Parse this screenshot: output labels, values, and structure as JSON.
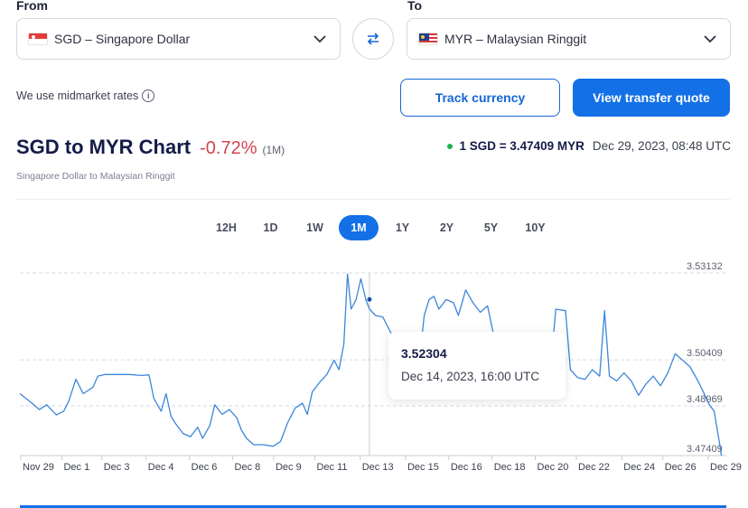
{
  "converter": {
    "from_label": "From",
    "to_label": "To",
    "from_value": "SGD – Singapore Dollar",
    "to_value": "MYR – Malaysian Ringgit",
    "midmarket_text": "We use midmarket rates",
    "track_button": "Track currency",
    "quote_button": "View transfer quote"
  },
  "header": {
    "title": "SGD to MYR Chart",
    "change": "-0.72%",
    "change_period": "(1M)",
    "subtitle": "Singapore Dollar to Malaysian Ringgit",
    "rate": "1 SGD = 3.47409 MYR",
    "timestamp": "Dec 29, 2023, 08:48 UTC"
  },
  "periods": [
    "12H",
    "1D",
    "1W",
    "1M",
    "1Y",
    "2Y",
    "5Y",
    "10Y"
  ],
  "active_period": "1M",
  "tooltip": {
    "value": "3.52304",
    "date": "Dec 14, 2023, 16:00 UTC"
  },
  "colors": {
    "accent": "#1370e6",
    "line": "#3c86da",
    "negative": "#d0454c",
    "live_dot": "#1fb24c"
  },
  "chart_data": {
    "type": "line",
    "series": [
      {
        "values": [
          [
            0,
            3.4935
          ],
          [
            0.5,
            3.4905
          ],
          [
            0.8,
            3.4885
          ],
          [
            1.1,
            3.49
          ],
          [
            1.5,
            3.4868
          ],
          [
            1.8,
            3.488
          ],
          [
            2.0,
            3.491
          ],
          [
            2.3,
            3.498
          ],
          [
            2.6,
            3.4935
          ],
          [
            3.0,
            3.4955
          ],
          [
            3.2,
            3.499
          ],
          [
            3.5,
            3.4995
          ],
          [
            4.0,
            3.4995
          ],
          [
            4.5,
            3.4995
          ],
          [
            5.0,
            3.4992
          ],
          [
            5.3,
            3.4994
          ],
          [
            5.5,
            3.492
          ],
          [
            5.8,
            3.488
          ],
          [
            6.0,
            3.4935
          ],
          [
            6.2,
            3.4865
          ],
          [
            6.4,
            3.484
          ],
          [
            6.7,
            3.481
          ],
          [
            7.0,
            3.48
          ],
          [
            7.3,
            3.483
          ],
          [
            7.5,
            3.4795
          ],
          [
            7.8,
            3.4835
          ],
          [
            8.0,
            3.49
          ],
          [
            8.3,
            3.487
          ],
          [
            8.6,
            3.4885
          ],
          [
            8.9,
            3.486
          ],
          [
            9.1,
            3.482
          ],
          [
            9.3,
            3.4795
          ],
          [
            9.6,
            3.4775
          ],
          [
            10.0,
            3.4775
          ],
          [
            10.4,
            3.477
          ],
          [
            10.7,
            3.4785
          ],
          [
            11.0,
            3.4845
          ],
          [
            11.3,
            3.489
          ],
          [
            11.6,
            3.4905
          ],
          [
            11.8,
            3.487
          ],
          [
            12.0,
            3.494
          ],
          [
            12.3,
            3.497
          ],
          [
            12.6,
            3.4995
          ],
          [
            12.9,
            3.504
          ],
          [
            13.1,
            3.501
          ],
          [
            13.3,
            3.509
          ],
          [
            13.45,
            3.531
          ],
          [
            13.6,
            3.52
          ],
          [
            13.8,
            3.523
          ],
          [
            14.0,
            3.5295
          ],
          [
            14.2,
            3.523
          ],
          [
            14.35,
            3.52
          ],
          [
            14.6,
            3.518
          ],
          [
            14.9,
            3.5175
          ],
          [
            15.2,
            3.513
          ],
          [
            15.5,
            3.509
          ],
          [
            15.8,
            3.506
          ],
          [
            16.0,
            3.508
          ],
          [
            16.2,
            3.506
          ],
          [
            16.4,
            3.504
          ],
          [
            16.6,
            3.518
          ],
          [
            16.8,
            3.523
          ],
          [
            17.0,
            3.524
          ],
          [
            17.2,
            3.52
          ],
          [
            17.5,
            3.523
          ],
          [
            17.8,
            3.522
          ],
          [
            18.0,
            3.518
          ],
          [
            18.3,
            3.526
          ],
          [
            18.6,
            3.522
          ],
          [
            18.9,
            3.519
          ],
          [
            19.2,
            3.521
          ],
          [
            19.5,
            3.51
          ],
          [
            19.8,
            3.503
          ],
          [
            20.1,
            3.501
          ],
          [
            20.4,
            3.499
          ],
          [
            20.7,
            3.4975
          ],
          [
            21.0,
            3.502
          ],
          [
            21.4,
            3.499
          ],
          [
            21.8,
            3.502
          ],
          [
            22.0,
            3.52
          ],
          [
            22.4,
            3.5195
          ],
          [
            22.6,
            3.501
          ],
          [
            22.9,
            3.4985
          ],
          [
            23.2,
            3.498
          ],
          [
            23.5,
            3.501
          ],
          [
            23.8,
            3.499
          ],
          [
            24.0,
            3.5195
          ],
          [
            24.2,
            3.499
          ],
          [
            24.5,
            3.4975
          ],
          [
            24.8,
            3.5
          ],
          [
            25.1,
            3.4975
          ],
          [
            25.4,
            3.493
          ],
          [
            25.7,
            3.4965
          ],
          [
            26.0,
            3.499
          ],
          [
            26.3,
            3.496
          ],
          [
            26.6,
            3.5
          ],
          [
            26.9,
            3.506
          ],
          [
            27.2,
            3.504
          ],
          [
            27.5,
            3.502
          ],
          [
            27.8,
            3.498
          ],
          [
            28.0,
            3.495
          ],
          [
            28.3,
            3.49
          ],
          [
            28.5,
            3.488
          ],
          [
            28.7,
            3.479
          ],
          [
            28.8,
            3.47409
          ]
        ]
      }
    ],
    "x_ticks": [
      "Nov 29",
      "Dec 1",
      "Dec 3",
      "Dec 4",
      "Dec 6",
      "Dec 8",
      "Dec 9",
      "Dec 11",
      "Dec 13",
      "Dec 15",
      "Dec 16",
      "Dec 18",
      "Dec 20",
      "Dec 22",
      "Dec 24",
      "Dec 26",
      "Dec 29"
    ],
    "x_tick_values": [
      0,
      1.9,
      3.75,
      5.8,
      7.8,
      9.8,
      11.7,
      13.6,
      15.7,
      17.8,
      19.8,
      21.8,
      23.8,
      25.7,
      27.8,
      29.7,
      31.8
    ],
    "y_ticks": [
      "3.53132",
      "3.50409",
      "3.48969",
      "3.47409"
    ],
    "y_tick_values": [
      3.53132,
      3.50409,
      3.48969,
      3.47409
    ],
    "ylim": [
      3.47409,
      3.53132
    ],
    "xlim": [
      0,
      29
    ],
    "highlight_x": 14.35,
    "grid": "dashed horizontal"
  }
}
